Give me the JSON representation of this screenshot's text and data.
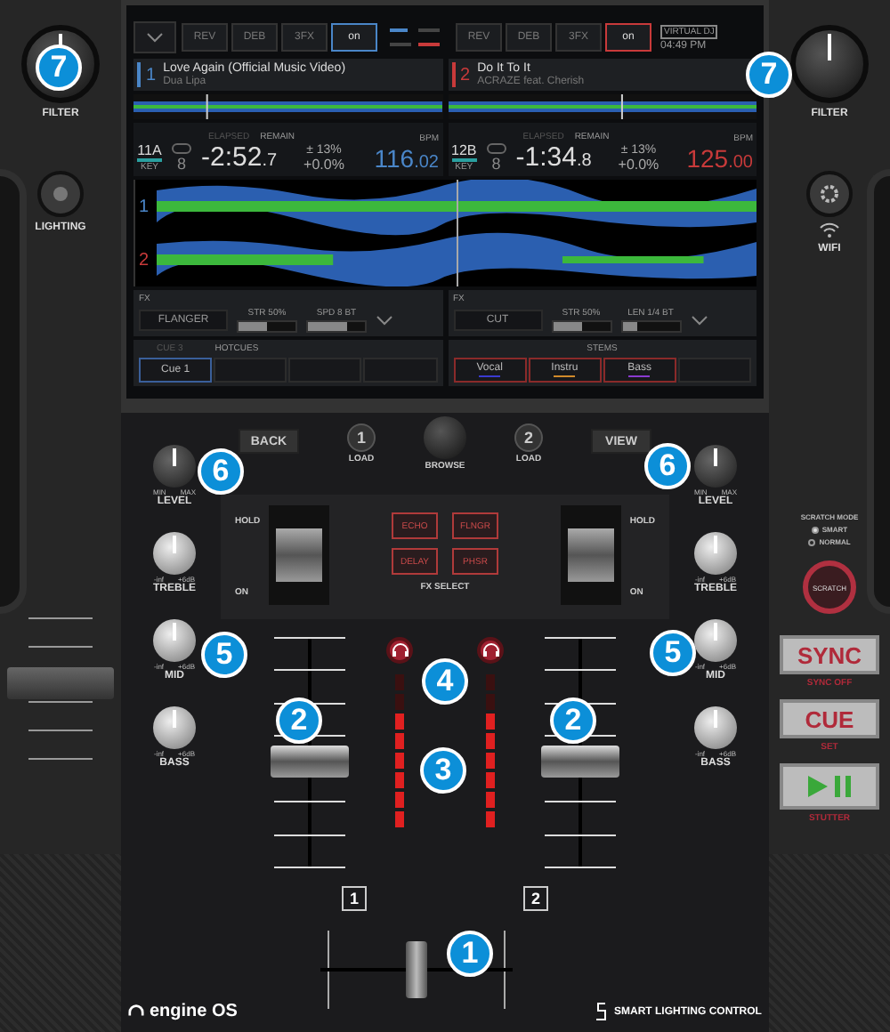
{
  "left_top": {
    "filter_label": "FILTER",
    "lighting_label": "LIGHTING"
  },
  "right_top": {
    "filter_label": "FILTER",
    "wifi_label": "WIFI"
  },
  "screen": {
    "clock": {
      "brand": "VIRTUAL DJ",
      "time": "04:49 PM"
    },
    "decks": [
      {
        "number": "1",
        "color": "#4a86c8",
        "title": "Love Again (Official Music Video)",
        "artist": "Dua Lipa",
        "fx_buttons": [
          {
            "label": "REV",
            "on": false
          },
          {
            "label": "DEB",
            "on": false
          },
          {
            "label": "3FX",
            "on": false
          },
          {
            "label": "on",
            "on": true
          }
        ],
        "key": "11A",
        "key_label": "KEY",
        "loop": "8",
        "elapsed_label": "ELAPSED",
        "remain_label": "REMAIN",
        "time": "-2:52",
        "time_fraction": ".7",
        "pitch_range": "± 13%",
        "pitch": "+0.0%",
        "bpm_label": "BPM",
        "bpm": "116",
        "bpm_fraction": ".02",
        "waveform_label": "1",
        "fx": {
          "label": "FX",
          "effect": "FLANGER",
          "params": [
            {
              "label": "STR 50%",
              "level": 0.5
            },
            {
              "label": "SPD 8 BT",
              "level": 0.7
            }
          ]
        }
      },
      {
        "number": "2",
        "color": "#c83a3a",
        "title": "Do It To It",
        "artist": "ACRAZE feat. Cherish",
        "fx_buttons": [
          {
            "label": "REV",
            "on": false
          },
          {
            "label": "DEB",
            "on": false
          },
          {
            "label": "3FX",
            "on": false
          },
          {
            "label": "on",
            "on": true
          }
        ],
        "key": "12B",
        "key_label": "KEY",
        "loop": "8",
        "elapsed_label": "ELAPSED",
        "remain_label": "REMAIN",
        "time": "-1:34",
        "time_fraction": ".8",
        "pitch_range": "± 13%",
        "pitch": "+0.0%",
        "bpm_label": "BPM",
        "bpm": "125",
        "bpm_fraction": ".00",
        "waveform_label": "2",
        "fx": {
          "label": "FX",
          "effect": "CUT",
          "params": [
            {
              "label": "STR 50%",
              "level": 0.5
            },
            {
              "label": "LEN 1/4 BT",
              "level": 0.25
            }
          ]
        }
      }
    ],
    "hotcues": {
      "caption": "CUE 3",
      "heading": "HOTCUES",
      "pads": [
        {
          "label": "Cue 1",
          "selected": true
        },
        {
          "selected": false
        },
        {
          "selected": false
        },
        {
          "selected": false
        }
      ]
    },
    "stems": {
      "heading": "STEMS",
      "pads": [
        {
          "label": "Vocal",
          "color": "#3a3ad0",
          "on": true
        },
        {
          "label": "Instru",
          "color": "#d08a2a",
          "on": true
        },
        {
          "label": "Bass",
          "color": "#8a3ad0",
          "on": true
        },
        {
          "on": false
        }
      ]
    }
  },
  "mixer": {
    "back": "BACK",
    "view": "VIEW",
    "browse": "BROWSE",
    "channels": [
      {
        "number": "1",
        "load_number": "1",
        "load_label": "LOAD",
        "hold": "HOLD",
        "on": "ON",
        "paddle_on": false,
        "fader": {
          "level": 0.45
        },
        "meter": {
          "level": 0.75
        },
        "knobs": [
          {
            "kind": "level",
            "label": "LEVEL",
            "min": "MIN",
            "max": "MAX"
          },
          {
            "kind": "eq",
            "label": "TREBLE",
            "min": "-inf",
            "max": "+6dB"
          },
          {
            "kind": "eq",
            "label": "MID",
            "min": "-inf",
            "max": "+6dB"
          },
          {
            "kind": "eq",
            "label": "BASS",
            "min": "-inf",
            "max": "+6dB"
          }
        ]
      },
      {
        "number": "2",
        "load_number": "2",
        "load_label": "LOAD",
        "hold": "HOLD",
        "on": "ON",
        "paddle_on": false,
        "fader": {
          "level": 0.45
        },
        "meter": {
          "level": 0.75
        },
        "knobs": [
          {
            "kind": "level",
            "label": "LEVEL",
            "min": "MIN",
            "max": "MAX"
          },
          {
            "kind": "eq",
            "label": "TREBLE",
            "min": "-inf",
            "max": "+6dB"
          },
          {
            "kind": "eq",
            "label": "MID",
            "min": "-inf",
            "max": "+6dB"
          },
          {
            "kind": "eq",
            "label": "BASS",
            "min": "-inf",
            "max": "+6dB"
          }
        ]
      }
    ],
    "fx_select": {
      "label": "FX SELECT",
      "buttons": [
        "ECHO",
        "FLNGR",
        "DELAY",
        "PHSR"
      ]
    },
    "crossfader": {
      "level": 0.5
    },
    "logo": "engine OS",
    "lighting_logo": "SMART LIGHTING CONTROL"
  },
  "transport": {
    "scratch_mode": {
      "title": "SCRATCH MODE",
      "options": [
        {
          "label": "SMART",
          "selected": true
        },
        {
          "label": "NORMAL",
          "selected": false
        }
      ]
    },
    "scratch_button": "SCRATCH",
    "sync": {
      "label": "SYNC",
      "caption": "SYNC OFF"
    },
    "cue": {
      "label": "CUE",
      "caption": "SET"
    },
    "play": {
      "caption": "STUTTER"
    }
  },
  "callouts": [
    "7",
    "7",
    "6",
    "6",
    "5",
    "5",
    "4",
    "2",
    "2",
    "3",
    "1"
  ]
}
